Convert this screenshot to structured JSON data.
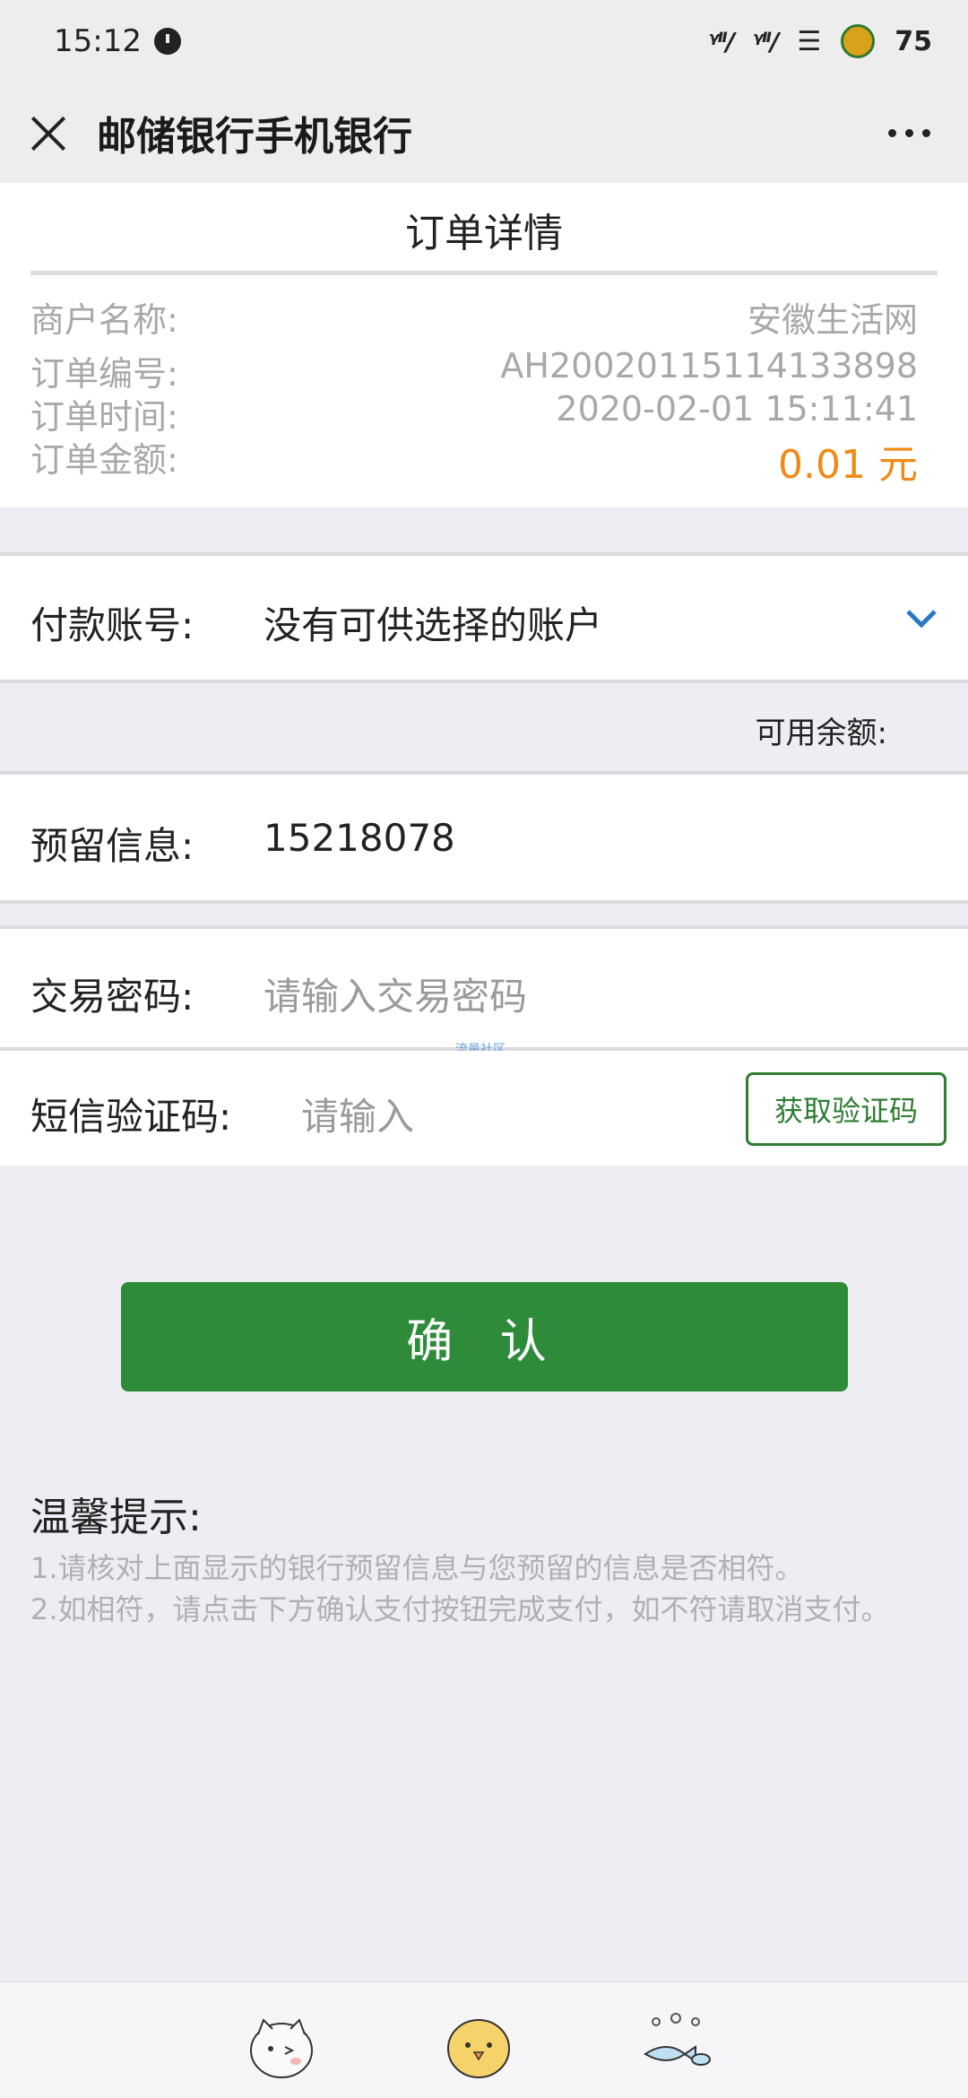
{
  "status": {
    "time": "15:12",
    "signal1": "㏌",
    "signal2": "㏌",
    "battery": "75"
  },
  "header": {
    "title": "邮储银行手机银行"
  },
  "order": {
    "title": "订单详情",
    "merchant_label": "商户名称:",
    "merchant_value": "安徽生活网",
    "order_no_label": "订单编号:",
    "order_no_value": "AH20020115114133898",
    "order_time_label": "订单时间:",
    "order_time_value": "2020-02-01 15:11:41",
    "amount_label": "订单金额:",
    "amount_value": "0.01 元"
  },
  "form": {
    "account_label": "付款账号:",
    "account_value": "没有可供选择的账户",
    "balance_label": "可用余额:",
    "reserved_label": "预留信息:",
    "reserved_value": "15218078",
    "password_label": "交易密码:",
    "password_placeholder": "请输入交易密码",
    "sms_label": "短信验证码:",
    "sms_placeholder": "请输入",
    "sms_button": "获取验证码",
    "watermark": "流量社区"
  },
  "confirm_label": "确 认",
  "tips": {
    "title": "温馨提示:",
    "line1": "1.请核对上面显示的银行预留信息与您预留的信息是否相符。",
    "line2": "2.如相符，请点击下方确认支付按钮完成支付，如不符请取消支付。"
  },
  "bottom_stickers": [
    "cat-sticker-icon",
    "chick-sticker-icon",
    "fish-sticker-icon"
  ]
}
